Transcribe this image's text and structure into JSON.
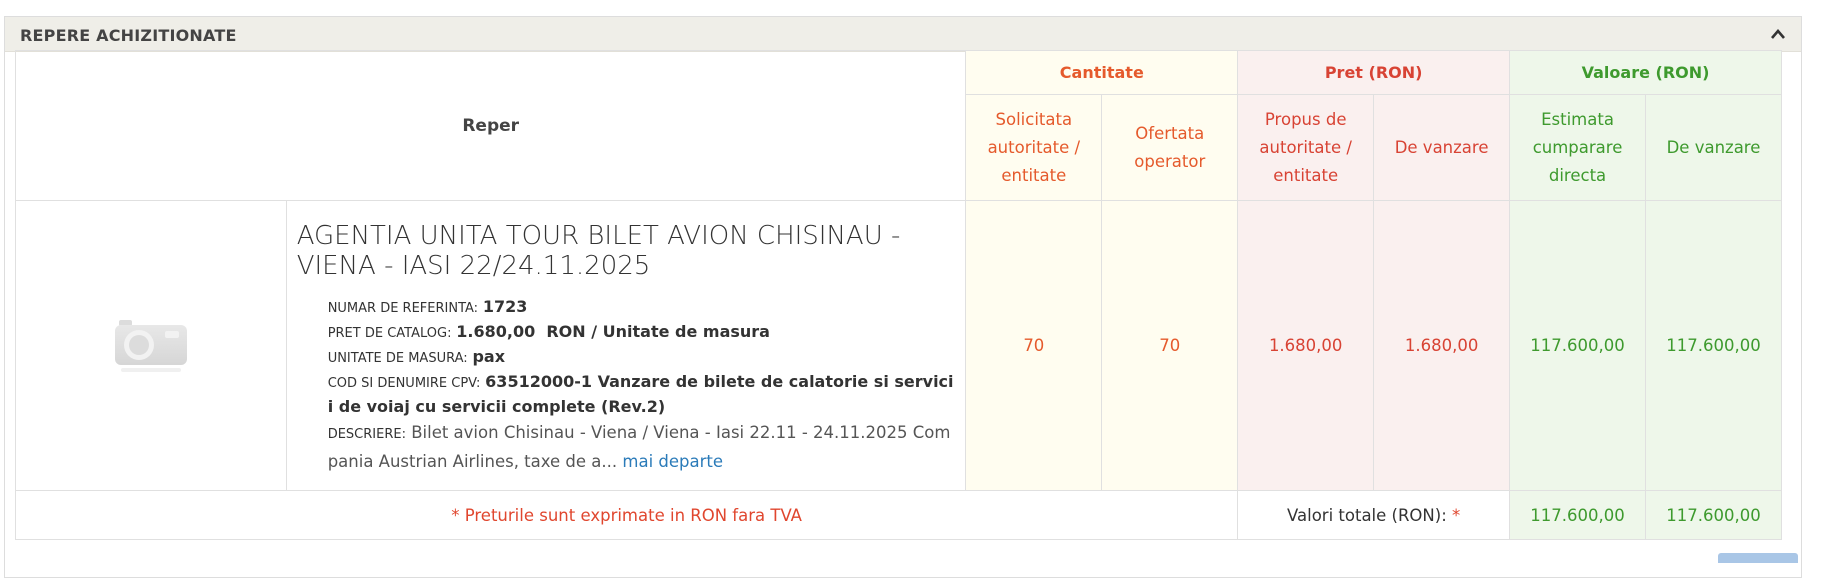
{
  "panel": {
    "title": "REPERE ACHIZITIONATE",
    "collapse_icon": "chevron-up-icon"
  },
  "table": {
    "header": {
      "reper": "Reper",
      "groups": {
        "cantitate": "Cantitate",
        "pret": "Pret (RON)",
        "valoare": "Valoare (RON)"
      },
      "sub": {
        "solicitata": "Solicitata autoritate / entitate",
        "ofertata": "Ofertata operator",
        "propus": "Propus de autoritate / entitate",
        "pret_vanzare": "De vanzare",
        "estimata": "Estimata cumparare directa",
        "valoare_vanzare": "De vanzare"
      }
    },
    "row": {
      "image_icon": "camera-placeholder-icon",
      "title": "AGENTIA UNITA TOUR BILET AVION CHISINAU -VIENA - IASI 22/24.11.2025",
      "ref_label": "NUMAR DE REFERINTA:",
      "ref_value": "1723",
      "catalog_label": "PRET DE CATALOG:",
      "catalog_value": "1.680,00  RON / Unitate de masura",
      "unit_label": "UNITATE DE MASURA:",
      "unit_value": "pax",
      "cpv_label": "COD SI DENUMIRE CPV:",
      "cpv_value": "63512000-1 Vanzare de bilete de calatorie si servicii de voiaj cu servicii complete (Rev.2)",
      "desc_label": "DESCRIERE:",
      "desc_value": "Bilet avion Chisinau - Viena / Viena - Iasi 22.11 - 24.11.2025 Compania Austrian Airlines, taxe de a...",
      "more_link": "mai departe",
      "solicitata": "70",
      "ofertata": "70",
      "propus": "1.680,00",
      "pret_vanzare": "1.680,00",
      "estimata": "117.600,00",
      "valoare_vanzare": "117.600,00"
    },
    "footer": {
      "note": "* Preturile sunt exprimate in RON fara TVA",
      "totals_label": "Valori totale (RON):",
      "totals_star": "*",
      "total_estimata": "117.600,00",
      "total_vanzare": "117.600,00"
    }
  },
  "colors": {
    "cantitate_bg": "#fffdf0",
    "cantitate_text": "#e55a2c",
    "pret_bg": "#faf0ef",
    "pret_text": "#d84334",
    "valoare_bg": "#eef7ea",
    "valoare_text": "#3e9a2e",
    "link": "#2b7bb9"
  }
}
